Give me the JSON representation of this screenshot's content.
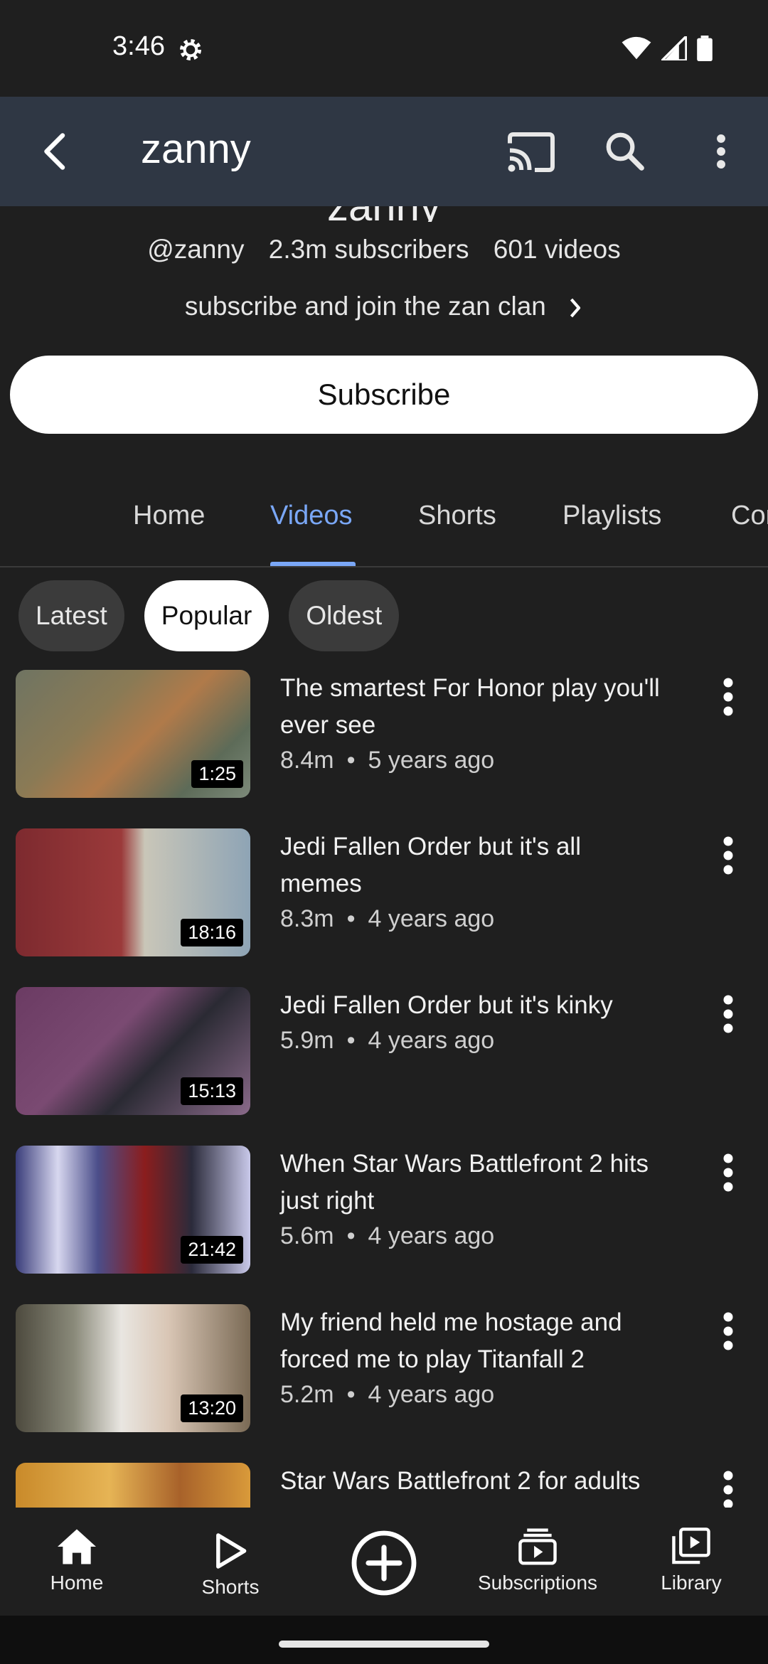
{
  "status_bar": {
    "time": "3:46"
  },
  "app_bar": {
    "title": "zanny"
  },
  "channel": {
    "name_cut": "zanny",
    "handle": "@zanny",
    "subscribers": "2.3m subscribers",
    "videos": "601 videos",
    "tagline": "subscribe and join the zan clan",
    "subscribe_label": "Subscribe"
  },
  "tabs": [
    {
      "label": "Home"
    },
    {
      "label": "Videos",
      "active": true
    },
    {
      "label": "Shorts"
    },
    {
      "label": "Playlists"
    },
    {
      "label": "Community"
    }
  ],
  "chips": [
    {
      "label": "Latest"
    },
    {
      "label": "Popular",
      "selected": true
    },
    {
      "label": "Oldest"
    }
  ],
  "videos": [
    {
      "title": "The smartest For Honor play you'll ever see",
      "views": "8.4m",
      "age": "5 years ago",
      "duration": "1:25"
    },
    {
      "title": "Jedi Fallen Order but it's all memes",
      "views": "8.3m",
      "age": "4 years ago",
      "duration": "18:16"
    },
    {
      "title": "Jedi Fallen Order but it's kinky",
      "views": "5.9m",
      "age": "4 years ago",
      "duration": "15:13"
    },
    {
      "title": "When Star Wars Battlefront 2 hits just right",
      "views": "5.6m",
      "age": "4 years ago",
      "duration": "21:42"
    },
    {
      "title": "My friend held me hostage and forced me to play Titanfall 2",
      "views": "5.2m",
      "age": "4 years ago",
      "duration": "13:20"
    },
    {
      "title": "Star Wars Battlefront 2 for adults",
      "views": "",
      "age": "",
      "duration": ""
    }
  ],
  "meta_separator": "•",
  "bottom_nav": [
    {
      "label": "Home",
      "icon": "home-icon"
    },
    {
      "label": "Shorts",
      "icon": "shorts-play-icon"
    },
    {
      "label": "",
      "icon": "create-plus-icon"
    },
    {
      "label": "Subscriptions",
      "icon": "subscriptions-icon"
    },
    {
      "label": "Library",
      "icon": "library-icon"
    }
  ],
  "colors": {
    "accent": "#7aa7f6",
    "app_bar": "#2f3744",
    "background": "#1f1f1f"
  }
}
